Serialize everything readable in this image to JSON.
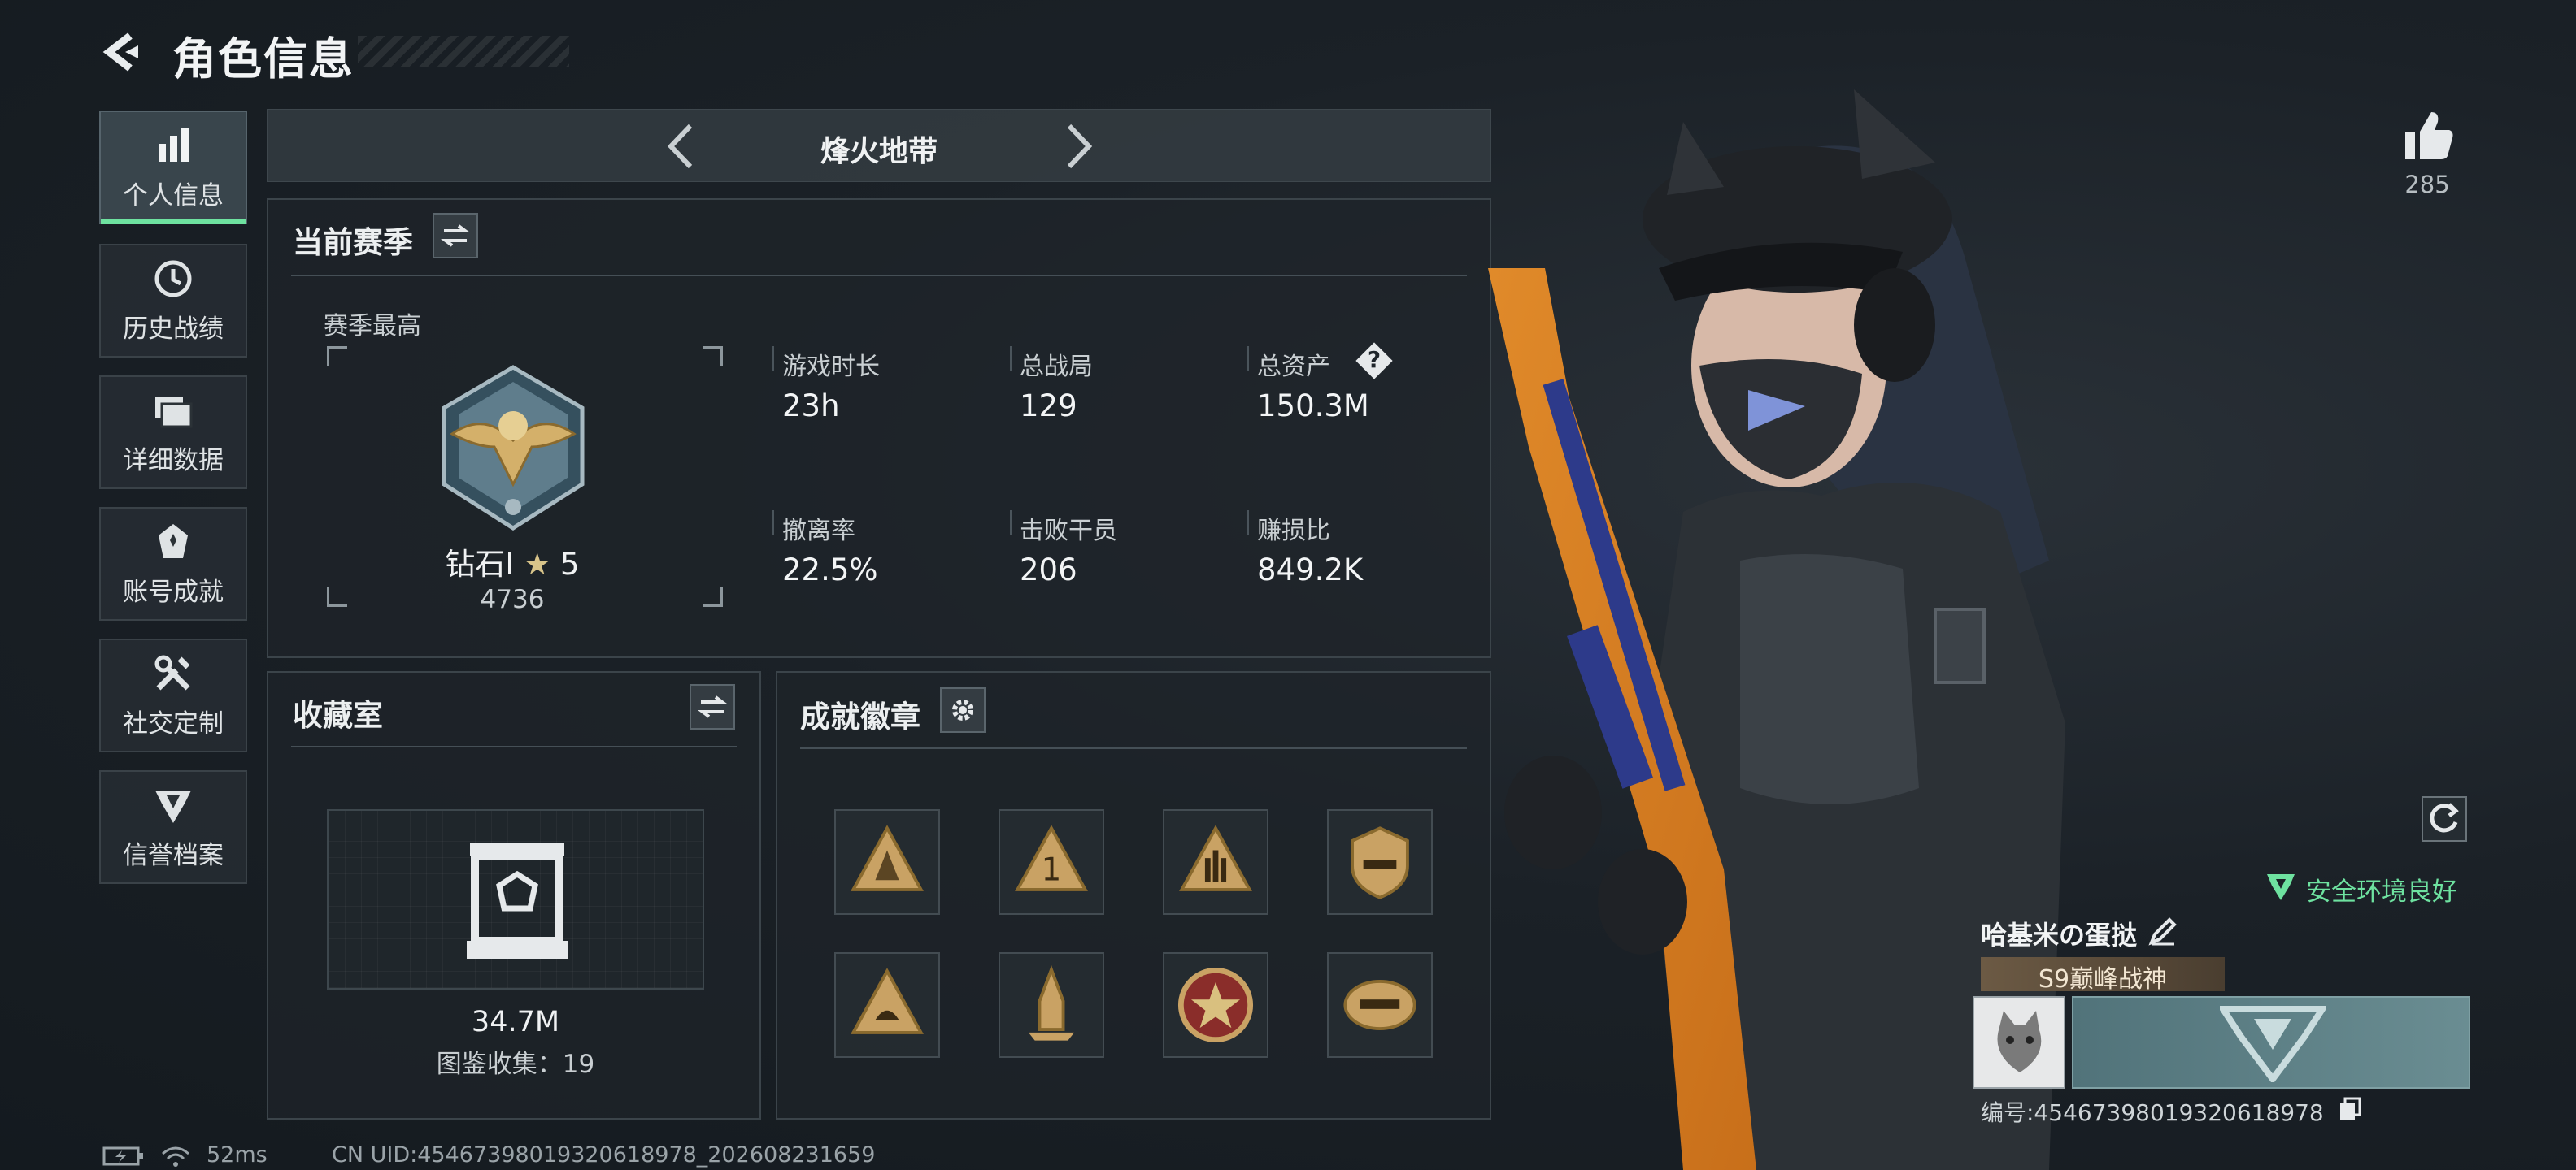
{
  "header": {
    "title": "角色信息"
  },
  "sidebar": {
    "items": [
      {
        "label": "个人信息",
        "icon": "bar-chart-icon",
        "active": true
      },
      {
        "label": "历史战绩",
        "icon": "history-icon"
      },
      {
        "label": "详细数据",
        "icon": "folders-icon"
      },
      {
        "label": "账号成就",
        "icon": "achievement-icon"
      },
      {
        "label": "社交定制",
        "icon": "tools-icon"
      },
      {
        "label": "信誉档案",
        "icon": "shield-emblem-icon"
      }
    ]
  },
  "mode": {
    "title": "烽火地带"
  },
  "season": {
    "title": "当前赛季",
    "best_label": "赛季最高",
    "rank_name": "钻石Ⅰ",
    "rank_stars": "5",
    "rank_score": "4736",
    "stats": [
      {
        "label": "游戏时长",
        "value": "23h"
      },
      {
        "label": "总战局",
        "value": "129"
      },
      {
        "label": "总资产",
        "value": "150.3M",
        "help": "?"
      },
      {
        "label": "撤离率",
        "value": "22.5%"
      },
      {
        "label": "击败干员",
        "value": "206"
      },
      {
        "label": "赚损比",
        "value": "849.2K"
      }
    ]
  },
  "collection": {
    "title": "收藏室",
    "value": "34.7M",
    "count_text": "图鉴收集：19"
  },
  "badges": {
    "title": "成就徽章",
    "items": [
      "triangle-badge-icon",
      "rank-one-badge-icon",
      "hand-sign-badge-icon",
      "shield-2025-badge-icon",
      "sail-badge-icon",
      "rocket-badge-icon",
      "star-medal-badge-icon",
      "helmet-badge-icon"
    ]
  },
  "player": {
    "likes": "285",
    "env_status": "安全环境良好",
    "name": "哈基米の蛋挞",
    "title_tag": "S9巅峰战神",
    "id_text": "编号:4546739801932061897​8"
  },
  "footer": {
    "ping": "52ms",
    "uid": "CN UID:4546739801932061897​8_202608231659"
  },
  "colors": {
    "accent_green": "#6ee2a0",
    "panel_border": "#3b444a"
  }
}
